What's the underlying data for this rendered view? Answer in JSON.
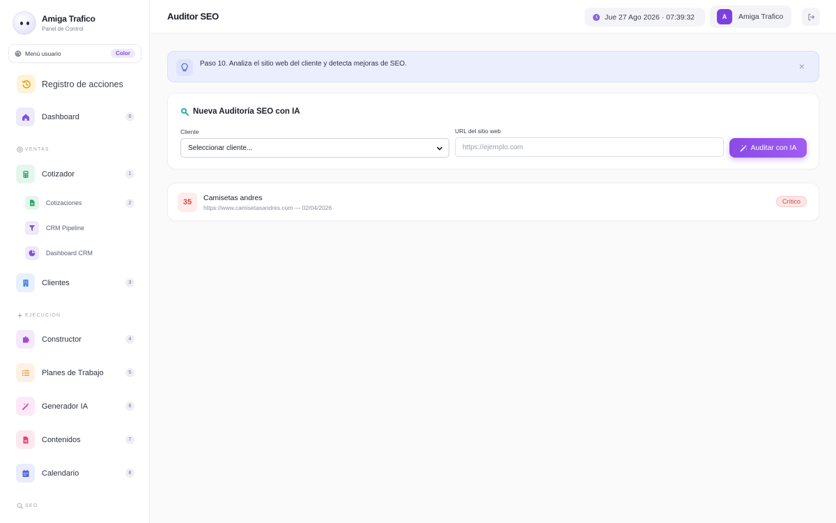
{
  "brand": {
    "name": "Amiga Trafico",
    "subtitle": "Panel de Control"
  },
  "user_menu": {
    "label": "Menú usuario",
    "color_badge": "Color"
  },
  "sidebar": {
    "registro": "Registro de acciones",
    "dashboard": {
      "label": "Dashboard",
      "badge": "0"
    },
    "section_ventas": "VENTAS",
    "cotizador": {
      "label": "Cotizador",
      "badge": "1"
    },
    "cotizaciones": {
      "label": "Cotizaciones",
      "badge": "2"
    },
    "crm_pipeline": {
      "label": "CRM Pipeline"
    },
    "dashboard_crm": {
      "label": "Dashboard CRM"
    },
    "clientes": {
      "label": "Clientes",
      "badge": "3"
    },
    "section_ejecucion": "EJECUCIÓN",
    "constructor": {
      "label": "Constructor",
      "badge": "4"
    },
    "planes": {
      "label": "Planes de Trabajo",
      "badge": "5"
    },
    "generador": {
      "label": "Generador IA",
      "badge": "6"
    },
    "contenidos": {
      "label": "Contenidos",
      "badge": "7"
    },
    "calendario": {
      "label": "Calendario",
      "badge": "8"
    },
    "section_seo": "SEO"
  },
  "header": {
    "title": "Auditor SEO",
    "datetime": "Jue 27 Ago 2026 · 07:39:32",
    "user_initial": "A",
    "user_name": "Amiga Trafico"
  },
  "tip": {
    "text": "Paso 10. Analiza el sitio web del cliente y detecta mejoras de SEO.",
    "close": "×"
  },
  "form": {
    "title": "Nueva Auditoría SEO con IA",
    "cliente_label": "Cliente",
    "cliente_value": "Seleccionar cliente...",
    "url_label": "URL del sitio web",
    "url_placeholder": "https://ejemplo.com",
    "submit_label": "Auditar con IA"
  },
  "results": [
    {
      "score": "35",
      "name": "Camisetas andres",
      "meta": "https://www.camisetasandres.com — 02/04/2026",
      "status": "Crítico"
    }
  ],
  "colors": {
    "accent": "#8a4ae6",
    "critical": "#d64545",
    "tip_bg": "#ebeefd"
  }
}
